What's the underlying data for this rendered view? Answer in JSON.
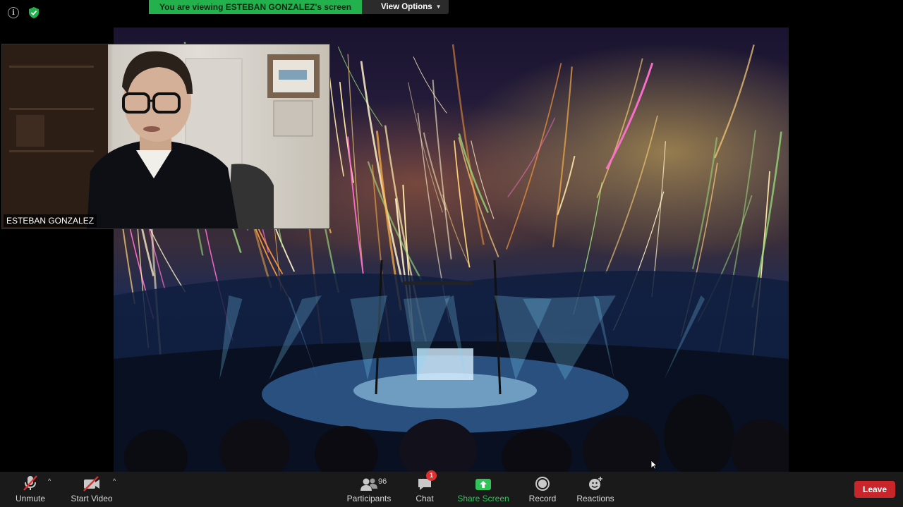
{
  "top_bar": {
    "info_icon": "info-icon",
    "security_icon": "shield-check-icon",
    "security_color": "#23b14d",
    "viewing_banner": "You are viewing ESTEBAN GONZALEZ's screen",
    "view_options": "View Options"
  },
  "video_tile": {
    "participant_name": "ESTEBAN GONZALEZ"
  },
  "toolbar": {
    "unmute_label": "Unmute",
    "start_video_label": "Start Video",
    "participants_label": "Participants",
    "participants_count": "96",
    "chat_label": "Chat",
    "chat_badge": "1",
    "share_screen_label": "Share Screen",
    "record_label": "Record",
    "reactions_label": "Reactions",
    "leave_label": "Leave",
    "accent_green": "#2fc35a",
    "leave_color": "#c8262b"
  }
}
